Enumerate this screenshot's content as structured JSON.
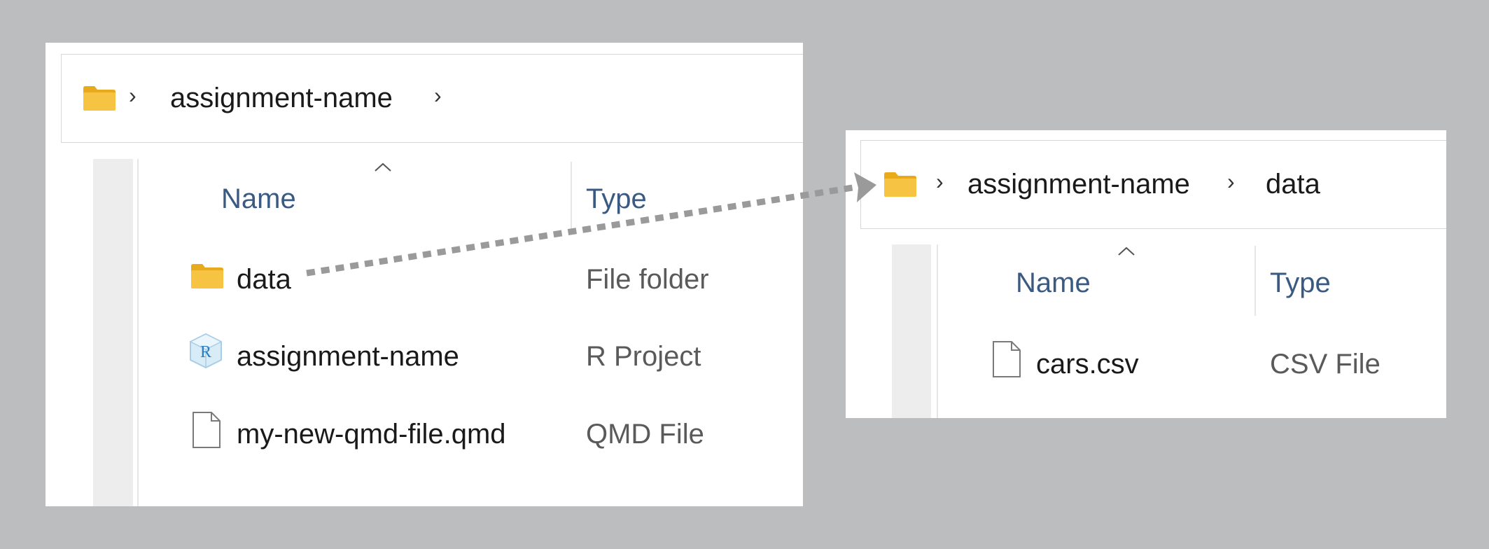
{
  "left_window": {
    "breadcrumb": [
      {
        "label": "assignment-name"
      }
    ],
    "columns": {
      "name": "Name",
      "type": "Type"
    },
    "rows": [
      {
        "name": "data",
        "type": "File folder",
        "icon": "folder-icon"
      },
      {
        "name": "assignment-name",
        "type": "R Project",
        "icon": "r-project-icon"
      },
      {
        "name": "my-new-qmd-file.qmd",
        "type": "QMD File",
        "icon": "file-icon"
      }
    ]
  },
  "right_window": {
    "breadcrumb": [
      {
        "label": "assignment-name"
      },
      {
        "label": "data"
      }
    ],
    "columns": {
      "name": "Name",
      "type": "Type"
    },
    "rows": [
      {
        "name": "cars.csv",
        "type": "CSV File",
        "icon": "file-icon"
      }
    ]
  },
  "colors": {
    "background": "#bcbdbf",
    "folder": "#f6c343",
    "column_header": "#3b5a82",
    "arrow": "#9a9a9a"
  }
}
